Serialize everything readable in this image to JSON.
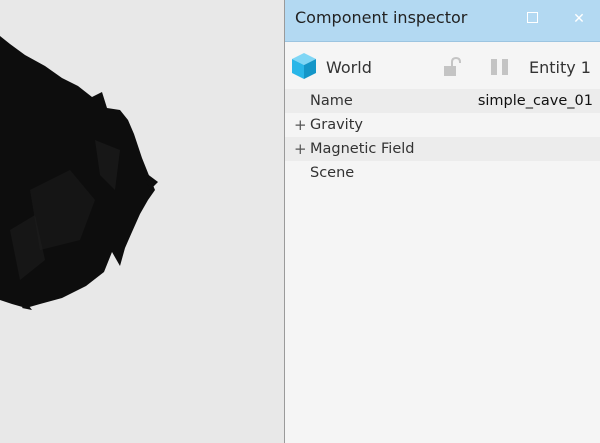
{
  "window": {
    "title": "Component inspector"
  },
  "toolbar": {
    "icon": "cube-icon",
    "entity_type": "World",
    "lock_icon": "unlock-icon",
    "pause_icon": "pause-icon",
    "entity_label": "Entity 1"
  },
  "properties": [
    {
      "name": "Name",
      "value": "simple_cave_01",
      "expandable": false
    },
    {
      "name": "Gravity",
      "value": "",
      "expandable": true,
      "expander": "+"
    },
    {
      "name": "Magnetic Field",
      "value": "",
      "expandable": true,
      "expander": "+"
    },
    {
      "name": "Scene",
      "value": "",
      "expandable": false
    }
  ],
  "colors": {
    "titlebar": "#b3d9f2",
    "viewport_bg": "#e8e8e8",
    "cube": "#29b6e8",
    "model": "#0d0d0d"
  }
}
